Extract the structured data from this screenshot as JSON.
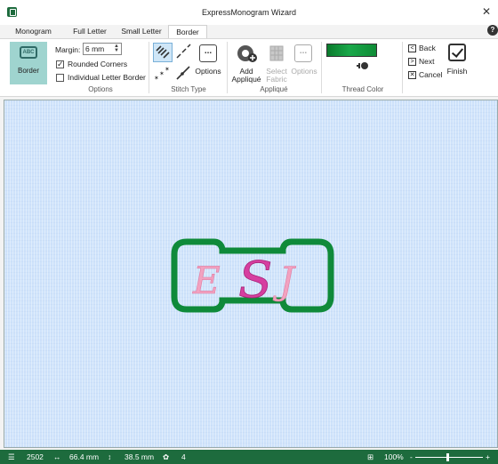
{
  "window": {
    "title": "ExpressMonogram Wizard",
    "close": "✕",
    "help": "?"
  },
  "tabs": [
    {
      "label": "Monogram",
      "active": false
    },
    {
      "label": "Full Letter",
      "active": false
    },
    {
      "label": "Small Letter",
      "active": false
    },
    {
      "label": "Border",
      "active": true
    }
  ],
  "ribbon": {
    "options_group": {
      "border_button": "Border",
      "border_icon_text": "ABC",
      "margin_label": "Margin:",
      "margin_value": "6 mm",
      "rounded_corners": {
        "label": "Rounded Corners",
        "checked": true
      },
      "individual_letter_border": {
        "label": "Individual Letter Border",
        "checked": false
      },
      "label": "Options"
    },
    "stitch_type_group": {
      "options_label": "Options",
      "options_glyph": "...",
      "label": "Stitch Type"
    },
    "applique_group": {
      "add_applique": "Add\nAppliqué",
      "select_fabric": "Select\nFabric",
      "options_label": "Options",
      "options_glyph": "...",
      "label": "Appliqué"
    },
    "thread_color_group": {
      "label": "Thread Color",
      "color": "#1aa84a"
    },
    "nav": {
      "back": "Back",
      "next": "Next",
      "cancel": "Cancel",
      "finish": "Finish",
      "back_glyph": "<",
      "next_glyph": ">",
      "cancel_glyph": "✕"
    }
  },
  "monogram": {
    "letters": [
      "E",
      "S",
      "J"
    ],
    "border_color": "#0f8a3a",
    "left_right_color": "#f2a2c0",
    "center_color": "#d63ea0"
  },
  "status_bar": {
    "stitch_count": "2502",
    "width": "66.4 mm",
    "height": "38.5 mm",
    "colors": "4",
    "zoom": "100%",
    "zoom_minus": "-",
    "zoom_plus": "+"
  }
}
